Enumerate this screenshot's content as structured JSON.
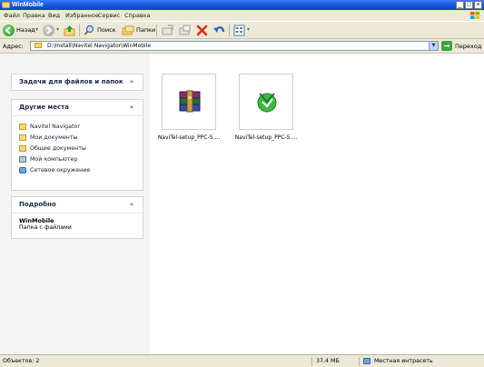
{
  "window": {
    "title": "WinMobile"
  },
  "menu": [
    {
      "label": "Файл"
    },
    {
      "label": "Правка"
    },
    {
      "label": "Вид"
    },
    {
      "label": "Избранное"
    },
    {
      "label": "Сервис"
    },
    {
      "label": "Справка"
    }
  ],
  "toolbar": {
    "back_label": "Назад",
    "search_label": "Поиск",
    "folders_label": "Папки"
  },
  "address": {
    "label": "Адрес:",
    "value": "D:\\Install\\Navitel Navigator\\WinMobile",
    "go_label": "Переход"
  },
  "tasks_panel": {
    "title": "Задачи для файлов и папок"
  },
  "places_panel": {
    "title": "Другие места",
    "items": [
      {
        "label": "Navitel Navigator",
        "icon": "folder-icon"
      },
      {
        "label": "Мои документы",
        "icon": "folder-icon"
      },
      {
        "label": "Общие документы",
        "icon": "folder-icon"
      },
      {
        "label": "Мой компьютер",
        "icon": "computer-icon"
      },
      {
        "label": "Сетевое окружение",
        "icon": "network-icon"
      }
    ]
  },
  "details_panel": {
    "title": "Подробно",
    "name": "WinMobile",
    "type": "Папка с файлами"
  },
  "files": [
    {
      "name": "NaviTel-setup_PPC-5....",
      "icon": "winrar-archive-icon"
    },
    {
      "name": "NaviTel-setup_PPC-5....",
      "icon": "navitel-setup-icon"
    }
  ],
  "status": {
    "objects": "Объектов: 2",
    "size": "37,4 МБ",
    "zone": "Местная интрасеть"
  },
  "colors": {
    "titlebar": "#1755e0",
    "pane_bg": "#f4f4f4",
    "window_bg": "#ece9d8"
  }
}
